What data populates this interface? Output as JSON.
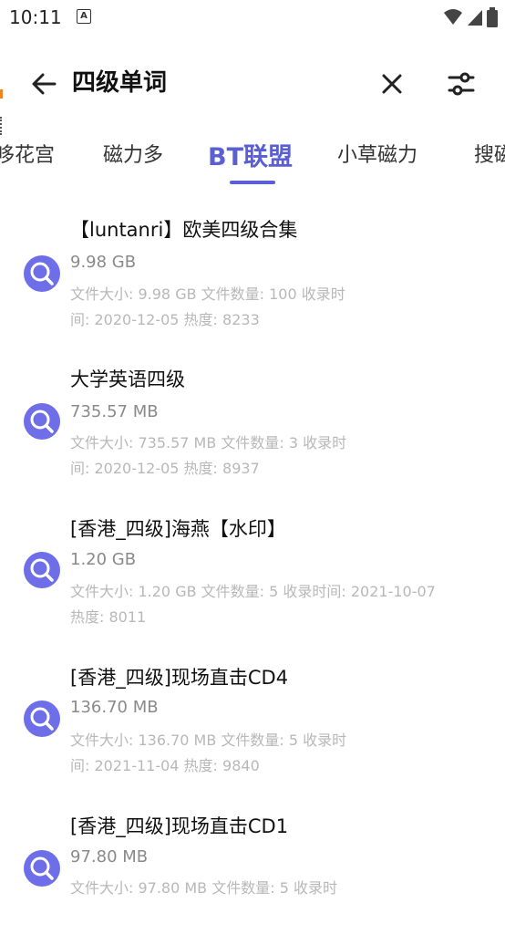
{
  "status_bar": {
    "time": "10:11",
    "notification_icon": "A"
  },
  "app_bar": {
    "title": "四级单词",
    "icons": [
      "back-arrow-icon",
      "close-icon",
      "filter-sliders-icon"
    ]
  },
  "tabs": [
    {
      "label": "哆花宫",
      "active": false
    },
    {
      "label": "磁力多",
      "active": false
    },
    {
      "label": "BT联盟",
      "active": true
    },
    {
      "label": "小草磁力",
      "active": false
    },
    {
      "label": "搜磁",
      "active": false
    }
  ],
  "colors": {
    "accent": "#5b5fd4",
    "icon_bg": "#6e6ee8",
    "meta_text": "#b8b8b8"
  },
  "results": [
    {
      "title": "【luntanri】欧美四级合集",
      "size": "9.98 GB",
      "meta_line1": "文件大小: 9.98 GB   文件数量: 100  收录时",
      "meta_line2": "间: 2020-12-05   热度: 8233"
    },
    {
      "title": "大学英语四级",
      "size": "735.57 MB",
      "meta_line1": "文件大小: 735.57 MB   文件数量: 3  收录时",
      "meta_line2": "间: 2020-12-05   热度: 8937"
    },
    {
      "title": "[香港_四级]海燕【水印】",
      "size": "1.20 GB",
      "meta_line1": "文件大小: 1.20 GB   文件数量: 5  收录时间: 2021-10-07",
      "meta_line2": "热度: 8011"
    },
    {
      "title": "[香港_四级]现场直击CD4",
      "size": "136.70 MB",
      "meta_line1": "文件大小: 136.70 MB   文件数量: 5  收录时",
      "meta_line2": "间: 2021-11-04   热度: 9840"
    },
    {
      "title": "[香港_四级]现场直击CD1",
      "size": "97.80 MB",
      "meta_line1": "文件大小: 97.80 MB   文件数量: 5  收录时",
      "meta_line2": ""
    }
  ]
}
